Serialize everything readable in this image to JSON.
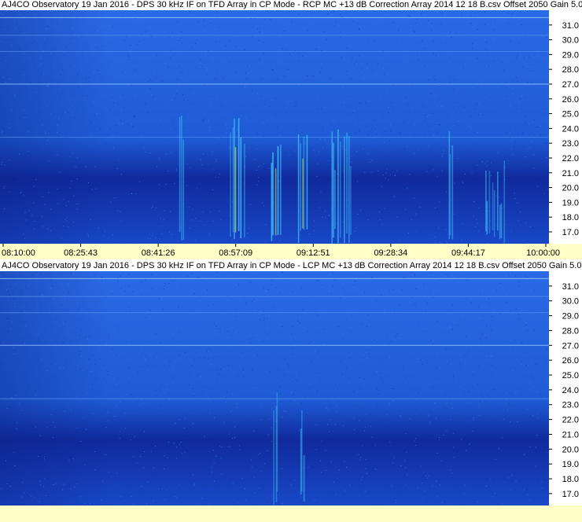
{
  "chart_data": [
    {
      "type": "heatmap",
      "title": "AJ4CO Observatory 19 Jan 2016 - DPS 30 kHz IF on TFD Array in CP Mode - RCP  MC +13 dB  Correction Array 2014 12 18 B.csv  Offset 2050  Gain 5.0",
      "x_tick_labels": [
        "08:10:00",
        "08:25:43",
        "08:41:26",
        "08:57:09",
        "09:12:51",
        "09:28:34",
        "09:44:17",
        "10:00:00"
      ],
      "y_tick_labels": [
        "31.0",
        "30.0",
        "29.0",
        "28.0",
        "27.0",
        "26.0",
        "25.0",
        "24.0",
        "23.0",
        "22.0",
        "21.0",
        "20.0",
        "19.0",
        "18.0",
        "17.0"
      ],
      "ylim": [
        16.2,
        32.0
      ],
      "colors": {
        "background": "#1e5bd6",
        "dark": "#102a9c",
        "bright": "#40c8ff",
        "hot": "#d8f040"
      },
      "bursts": [
        {
          "t": 0.33,
          "f": 21.5,
          "w": 0.01,
          "i": 0.6
        },
        {
          "t": 0.43,
          "f": 21.0,
          "w": 0.03,
          "i": 0.9
        },
        {
          "t": 0.5,
          "f": 19.5,
          "w": 0.02,
          "i": 1.0
        },
        {
          "t": 0.55,
          "f": 19.0,
          "w": 0.02,
          "i": 0.9
        },
        {
          "t": 0.62,
          "f": 19.5,
          "w": 0.04,
          "i": 0.7
        },
        {
          "t": 0.82,
          "f": 20.0,
          "w": 0.01,
          "i": 0.5
        },
        {
          "t": 0.9,
          "f": 17.2,
          "w": 0.04,
          "i": 0.6
        }
      ]
    },
    {
      "type": "heatmap",
      "title": "AJ4CO Observatory 19 Jan 2016 - DPS 30 kHz IF on TFD Array in CP Mode - LCP  MC +13 dB  Correction Array 2014 12 18 B.csv  Offset 2050  Gain 5.0",
      "x_tick_labels": [],
      "y_tick_labels": [
        "31.0",
        "30.0",
        "29.0",
        "28.0",
        "27.0",
        "26.0",
        "25.0",
        "24.0",
        "23.0",
        "22.0",
        "21.0",
        "20.0",
        "19.0",
        "18.0",
        "17.0"
      ],
      "ylim": [
        16.2,
        32.0
      ],
      "colors": {
        "background": "#1e5bd6",
        "dark": "#102a9c",
        "bright": "#40c8ff",
        "hot": "#d8f040"
      },
      "bursts": [
        {
          "t": 0.5,
          "f": 19.5,
          "w": 0.01,
          "i": 0.4
        },
        {
          "t": 0.55,
          "f": 18.0,
          "w": 0.01,
          "i": 0.5
        }
      ]
    }
  ]
}
